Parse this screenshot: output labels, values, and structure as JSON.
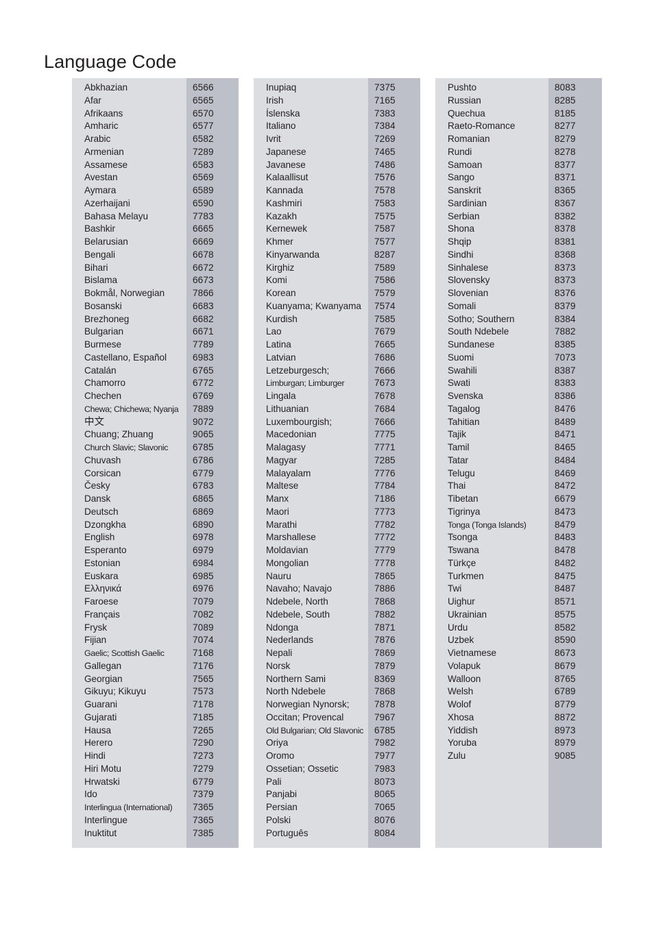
{
  "page": {
    "title": "Language Code"
  },
  "table": {
    "columns": [
      {
        "rows": [
          {
            "name": "Abkhazian",
            "code": "6566"
          },
          {
            "name": "Afar",
            "code": "6565"
          },
          {
            "name": "Afrikaans",
            "code": "6570"
          },
          {
            "name": "Amharic",
            "code": "6577"
          },
          {
            "name": "Arabic",
            "code": "6582"
          },
          {
            "name": "Armenian",
            "code": "7289"
          },
          {
            "name": "Assamese",
            "code": "6583"
          },
          {
            "name": "Avestan",
            "code": "6569"
          },
          {
            "name": "Aymara",
            "code": "6589"
          },
          {
            "name": "Azerhaijani",
            "code": "6590"
          },
          {
            "name": "Bahasa Melayu",
            "code": "7783"
          },
          {
            "name": "Bashkir",
            "code": "6665"
          },
          {
            "name": "Belarusian",
            "code": "6669"
          },
          {
            "name": "Bengali",
            "code": "6678"
          },
          {
            "name": "Bihari",
            "code": "6672"
          },
          {
            "name": "Bislama",
            "code": "6673"
          },
          {
            "name": "Bokmål, Norwegian",
            "code": "7866"
          },
          {
            "name": "Bosanski",
            "code": "6683"
          },
          {
            "name": "Brezhoneg",
            "code": "6682"
          },
          {
            "name": "Bulgarian",
            "code": "6671"
          },
          {
            "name": "Burmese",
            "code": "7789"
          },
          {
            "name": "Castellano, Español",
            "code": "6983"
          },
          {
            "name": "Catalán",
            "code": "6765"
          },
          {
            "name": "Chamorro",
            "code": "6772"
          },
          {
            "name": "Chechen",
            "code": "6769"
          },
          {
            "name": "Chewa; Chichewa; Nyanja",
            "code": "7889"
          },
          {
            "name": "中文",
            "code": "9072"
          },
          {
            "name": "Chuang; Zhuang",
            "code": "9065"
          },
          {
            "name": "Church Slavic; Slavonic",
            "code": "6785"
          },
          {
            "name": "Chuvash",
            "code": "6786"
          },
          {
            "name": "Corsican",
            "code": "6779"
          },
          {
            "name": "Česky",
            "code": "6783"
          },
          {
            "name": "Dansk",
            "code": "6865"
          },
          {
            "name": "Deutsch",
            "code": "6869"
          },
          {
            "name": "Dzongkha",
            "code": "6890"
          },
          {
            "name": "English",
            "code": "6978"
          },
          {
            "name": "Esperanto",
            "code": "6979"
          },
          {
            "name": "Estonian",
            "code": "6984"
          },
          {
            "name": "Euskara",
            "code": "6985"
          },
          {
            "name": "Ελληνικά",
            "code": "6976"
          },
          {
            "name": "Faroese",
            "code": "7079"
          },
          {
            "name": "Français",
            "code": "7082"
          },
          {
            "name": "Frysk",
            "code": "7089"
          },
          {
            "name": "Fijian",
            "code": "7074"
          },
          {
            "name": "Gaelic; Scottish Gaelic",
            "code": "7168"
          },
          {
            "name": "Gallegan",
            "code": "7176"
          },
          {
            "name": "Georgian",
            "code": "7565"
          },
          {
            "name": "Gikuyu; Kikuyu",
            "code": "7573"
          },
          {
            "name": "Guarani",
            "code": "7178"
          },
          {
            "name": "Gujarati",
            "code": "7185"
          },
          {
            "name": "Hausa",
            "code": "7265"
          },
          {
            "name": "Herero",
            "code": "7290"
          },
          {
            "name": "Hindi",
            "code": "7273"
          },
          {
            "name": "Hiri Motu",
            "code": "7279"
          },
          {
            "name": "Hrwatski",
            "code": "6779"
          },
          {
            "name": "Ido",
            "code": "7379"
          },
          {
            "name": "Interlingua (International)",
            "code": "7365"
          },
          {
            "name": "Interlingue",
            "code": "7365"
          },
          {
            "name": "Inuktitut",
            "code": "7385"
          }
        ]
      },
      {
        "rows": [
          {
            "name": "Inupiaq",
            "code": "7375"
          },
          {
            "name": "Irish",
            "code": "7165"
          },
          {
            "name": "Íslenska",
            "code": "7383"
          },
          {
            "name": "Italiano",
            "code": "7384"
          },
          {
            "name": "Ivrit",
            "code": "7269"
          },
          {
            "name": "Japanese",
            "code": "7465"
          },
          {
            "name": "Javanese",
            "code": "7486"
          },
          {
            "name": "Kalaallisut",
            "code": "7576"
          },
          {
            "name": "Kannada",
            "code": "7578"
          },
          {
            "name": "Kashmiri",
            "code": "7583"
          },
          {
            "name": "Kazakh",
            "code": "7575"
          },
          {
            "name": "Kernewek",
            "code": "7587"
          },
          {
            "name": "Khmer",
            "code": "7577"
          },
          {
            "name": "Kinyarwanda",
            "code": "8287"
          },
          {
            "name": "Kirghiz",
            "code": "7589"
          },
          {
            "name": "Komi",
            "code": "7586"
          },
          {
            "name": "Korean",
            "code": "7579"
          },
          {
            "name": "Kuanyama; Kwanyama",
            "code": "7574"
          },
          {
            "name": "Kurdish",
            "code": "7585"
          },
          {
            "name": "Lao",
            "code": "7679"
          },
          {
            "name": "Latina",
            "code": "7665"
          },
          {
            "name": "Latvian",
            "code": "7686"
          },
          {
            "name": "Letzeburgesch;",
            "code": "7666"
          },
          {
            "name": "Limburgan; Limburger",
            "code": "7673"
          },
          {
            "name": "Lingala",
            "code": "7678"
          },
          {
            "name": "Lithuanian",
            "code": "7684"
          },
          {
            "name": "Luxembourgish;",
            "code": "7666"
          },
          {
            "name": "Macedonian",
            "code": "7775"
          },
          {
            "name": "Malagasy",
            "code": "7771"
          },
          {
            "name": "Magyar",
            "code": "7285"
          },
          {
            "name": "Malayalam",
            "code": "7776"
          },
          {
            "name": "Maltese",
            "code": "7784"
          },
          {
            "name": "Manx",
            "code": "7186"
          },
          {
            "name": "Maori",
            "code": "7773"
          },
          {
            "name": "Marathi",
            "code": "7782"
          },
          {
            "name": "Marshallese",
            "code": "7772"
          },
          {
            "name": "Moldavian",
            "code": "7779"
          },
          {
            "name": "Mongolian",
            "code": "7778"
          },
          {
            "name": "Nauru",
            "code": "7865"
          },
          {
            "name": "Navaho; Navajo",
            "code": "7886"
          },
          {
            "name": "Ndebele, North",
            "code": "7868"
          },
          {
            "name": "Ndebele, South",
            "code": "7882"
          },
          {
            "name": "Ndonga",
            "code": "7871"
          },
          {
            "name": "Nederlands",
            "code": "7876"
          },
          {
            "name": "Nepali",
            "code": "7869"
          },
          {
            "name": "Norsk",
            "code": "7879"
          },
          {
            "name": "Northern Sami",
            "code": "8369"
          },
          {
            "name": "North Ndebele",
            "code": "7868"
          },
          {
            "name": "Norwegian Nynorsk;",
            "code": "7878"
          },
          {
            "name": "Occitan; Provencal",
            "code": "7967"
          },
          {
            "name": "Old Bulgarian; Old Slavonic",
            "code": "6785"
          },
          {
            "name": "Oriya",
            "code": "7982"
          },
          {
            "name": "Oromo",
            "code": "7977"
          },
          {
            "name": "Ossetian; Ossetic",
            "code": "7983"
          },
          {
            "name": "Pali",
            "code": "8073"
          },
          {
            "name": "Panjabi",
            "code": "8065"
          },
          {
            "name": "Persian",
            "code": "7065"
          },
          {
            "name": "Polski",
            "code": "8076"
          },
          {
            "name": "Português",
            "code": "8084"
          }
        ]
      },
      {
        "rows": [
          {
            "name": "Pushto",
            "code": "8083"
          },
          {
            "name": "Russian",
            "code": "8285"
          },
          {
            "name": "Quechua",
            "code": "8185"
          },
          {
            "name": "Raeto-Romance",
            "code": "8277"
          },
          {
            "name": "Romanian",
            "code": "8279"
          },
          {
            "name": "Rundi",
            "code": "8278"
          },
          {
            "name": "Samoan",
            "code": "8377"
          },
          {
            "name": "Sango",
            "code": "8371"
          },
          {
            "name": "Sanskrit",
            "code": "8365"
          },
          {
            "name": "Sardinian",
            "code": "8367"
          },
          {
            "name": "Serbian",
            "code": "8382"
          },
          {
            "name": "Shona",
            "code": "8378"
          },
          {
            "name": "Shqip",
            "code": "8381"
          },
          {
            "name": "Sindhi",
            "code": "8368"
          },
          {
            "name": "Sinhalese",
            "code": "8373"
          },
          {
            "name": "Slovensky",
            "code": "8373"
          },
          {
            "name": "Slovenian",
            "code": "8376"
          },
          {
            "name": "Somali",
            "code": "8379"
          },
          {
            "name": "Sotho; Southern",
            "code": "8384"
          },
          {
            "name": "South Ndebele",
            "code": "7882"
          },
          {
            "name": "Sundanese",
            "code": "8385"
          },
          {
            "name": "Suomi",
            "code": "7073"
          },
          {
            "name": "Swahili",
            "code": "8387"
          },
          {
            "name": "Swati",
            "code": "8383"
          },
          {
            "name": "Svenska",
            "code": "8386"
          },
          {
            "name": "Tagalog",
            "code": "8476"
          },
          {
            "name": "Tahitian",
            "code": "8489"
          },
          {
            "name": "Tajik",
            "code": "8471"
          },
          {
            "name": "Tamil",
            "code": "8465"
          },
          {
            "name": "Tatar",
            "code": "8484"
          },
          {
            "name": "Telugu",
            "code": "8469"
          },
          {
            "name": "Thai",
            "code": "8472"
          },
          {
            "name": "Tibetan",
            "code": "6679"
          },
          {
            "name": "Tigrinya",
            "code": "8473"
          },
          {
            "name": "Tonga (Tonga Islands)",
            "code": "8479"
          },
          {
            "name": "Tsonga",
            "code": "8483"
          },
          {
            "name": "Tswana",
            "code": "8478"
          },
          {
            "name": "Türkçe",
            "code": "8482"
          },
          {
            "name": "Turkmen",
            "code": "8475"
          },
          {
            "name": "Twi",
            "code": "8487"
          },
          {
            "name": "Uighur",
            "code": "8571"
          },
          {
            "name": "Ukrainian",
            "code": "8575"
          },
          {
            "name": "Urdu",
            "code": "8582"
          },
          {
            "name": "Uzbek",
            "code": "8590"
          },
          {
            "name": "Vietnamese",
            "code": "8673"
          },
          {
            "name": "Volapuk",
            "code": "8679"
          },
          {
            "name": "Walloon",
            "code": "8765"
          },
          {
            "name": "Welsh",
            "code": "6789"
          },
          {
            "name": "Wolof",
            "code": "8779"
          },
          {
            "name": "Xhosa",
            "code": "8872"
          },
          {
            "name": "Yiddish",
            "code": "8973"
          },
          {
            "name": "Yoruba",
            "code": "8979"
          },
          {
            "name": "Zulu",
            "code": "9085"
          }
        ]
      }
    ]
  },
  "colors": {
    "name_block_bg": "#dcdde1",
    "code_block_bg": "#bdc0c8",
    "text": "#231f20",
    "page_bg": "#ffffff"
  }
}
